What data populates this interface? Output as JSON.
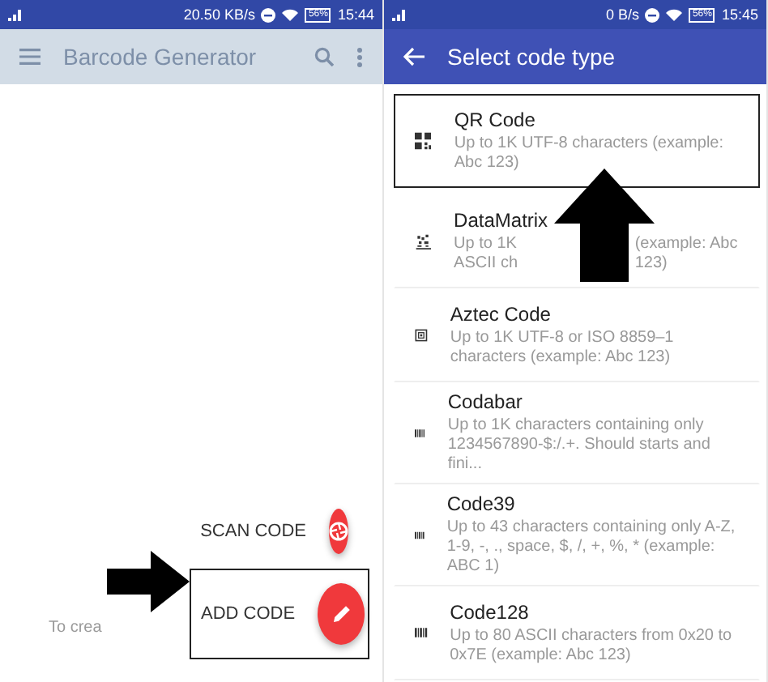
{
  "left_screen": {
    "status_bar": {
      "speed": "20.50 KB/s",
      "battery": "56%",
      "time": "15:44"
    },
    "toolbar": {
      "title": "Barcode Generator",
      "dimmed": true
    },
    "hint": "To crea",
    "fab_actions": [
      {
        "label": "SCAN CODE",
        "kind": "scan",
        "highlighted": false
      },
      {
        "label": "ADD CODE",
        "kind": "add",
        "highlighted": true
      }
    ]
  },
  "right_screen": {
    "status_bar": {
      "speed": "0 B/s",
      "battery": "56%",
      "time": "15:45"
    },
    "toolbar": {
      "title": "Select code type",
      "dimmed": false
    },
    "code_types": [
      {
        "name": "QR Code",
        "description": "Up to 1K UTF-8 characters (example: Abc 123)",
        "kind": "qr",
        "highlighted": true
      },
      {
        "name": "DataMatrix",
        "description": "Up to 1K ASCII ch",
        "description_tail": "(example: Abc 123)",
        "kind": "datamatrix",
        "highlighted": false
      },
      {
        "name": "Aztec Code",
        "description": "Up to 1K UTF-8 or ISO 8859–1 characters (example: Abc 123)",
        "kind": "aztec",
        "highlighted": false
      },
      {
        "name": "Codabar",
        "description": "Up to 1K characters containing only 1234567890-$:/.+. Should starts and fini...",
        "kind": "barcode",
        "highlighted": false
      },
      {
        "name": "Code39",
        "description": "Up to 43 characters containing only A-Z, 1-9, -, ., space, $, /, +, %, * (example: ABC 1)",
        "kind": "barcode",
        "highlighted": false
      },
      {
        "name": "Code128",
        "description": "Up to 80 ASCII characters from 0x20 to 0x7E (example: Abc 123)",
        "kind": "barcode",
        "highlighted": false
      }
    ]
  }
}
